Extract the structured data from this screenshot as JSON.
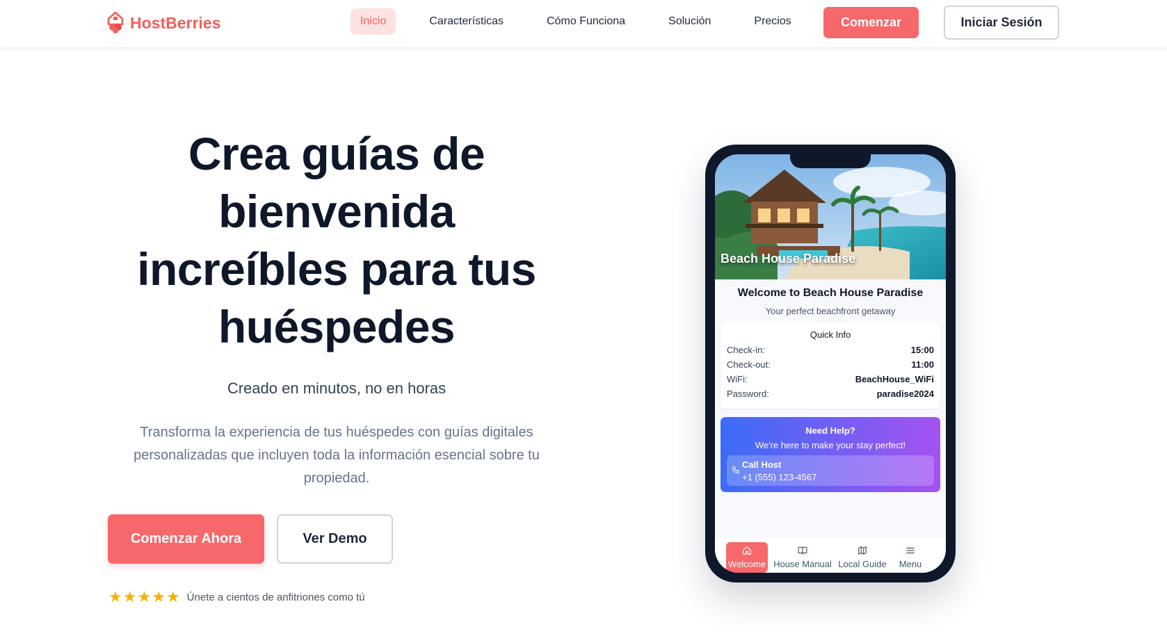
{
  "brand": {
    "name": "HostBerries",
    "color": "#f25f5c",
    "icon": "house-berry-icon"
  },
  "nav": {
    "links": [
      "Inicio",
      "Características",
      "Cómo Funciona",
      "Solución",
      "Precios"
    ],
    "active_index": 0,
    "cta_primary": "Comenzar",
    "cta_secondary": "Iniciar Sesión"
  },
  "hero": {
    "title": "Crea guías de bienvenida increíbles para tus huéspedes",
    "subtitle": "Creado en minutos, no en horas",
    "description": "Transforma la experiencia de tus huéspedes con guías digitales personalizadas que incluyen toda la información esencial sobre tu propiedad.",
    "cta_primary": "Comenzar Ahora",
    "cta_secondary": "Ver Demo",
    "rating": {
      "stars": 5,
      "text": "Únete a cientos de anfitriones como tú"
    }
  },
  "phone": {
    "image_title": "Beach House Paradise",
    "welcome_title": "Welcome to Beach House Paradise",
    "welcome_sub": "Your perfect beachfront getaway",
    "quick_info": {
      "title": "Quick Info",
      "rows": [
        {
          "label": "Check-in:",
          "value": "15:00"
        },
        {
          "label": "Check-out:",
          "value": "11:00"
        },
        {
          "label": "WiFi:",
          "value": "BeachHouse_WiFi"
        },
        {
          "label": "Password:",
          "value": "paradise2024"
        }
      ]
    },
    "help": {
      "title": "Need Help?",
      "subtitle": "We're here to make your stay perfect!",
      "call_label": "Call Host",
      "call_number": "+1 (555) 123-4567"
    },
    "tabs": [
      {
        "label": "Welcome",
        "icon": "home-icon",
        "active": true
      },
      {
        "label": "House Manual",
        "icon": "book-icon",
        "active": false
      },
      {
        "label": "Local Guide",
        "icon": "map-icon",
        "active": false
      },
      {
        "label": "Menu",
        "icon": "menu-icon",
        "active": false
      }
    ]
  },
  "colors": {
    "accent": "#f6686a",
    "accent_soft": "#fde2e2",
    "text_dark": "#0f172a",
    "help_gradient_start": "#3b6cf6",
    "help_gradient_end": "#a552f2"
  }
}
